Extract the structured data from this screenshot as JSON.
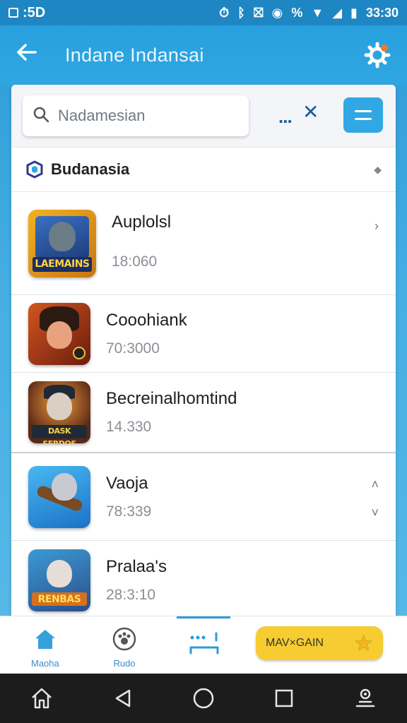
{
  "status_bar": {
    "left_text": ":5D",
    "time": "33:30",
    "percent_symbol": "%"
  },
  "app_bar": {
    "title": "Indane Indansai"
  },
  "search": {
    "placeholder": "Nadamesian",
    "more_label": "...",
    "close_label": "✕"
  },
  "section": {
    "title": "Budanasia"
  },
  "apps": [
    {
      "title": "Auplolsl",
      "subtitle": "18:060",
      "banner": "LAEMAINS",
      "bg": "#e9a01b",
      "face": "#6a7d87"
    },
    {
      "title": "Cooohiank",
      "subtitle": "70:3000",
      "banner": "",
      "bg": "#b5441c",
      "face": "#e8a27e"
    },
    {
      "title": "Becreinalhomtind",
      "subtitle": "14.330",
      "banner": "DASK SERDOS",
      "bg": "#2a2f3a",
      "face": "#d9cfc2"
    },
    {
      "title": "Vaoja",
      "subtitle": "78:339",
      "banner": "",
      "bg": "#2796e0",
      "face": "#c9c9d2"
    },
    {
      "title": "Pralaa's",
      "subtitle": "28:3:10",
      "banner": "RENBAS",
      "bg": "#3b6fa8",
      "face": "#e6ded6"
    }
  ],
  "bottom_nav": {
    "home_label": "Maoha",
    "second_label": "Rudo",
    "cta_label": "MAV×GAIN"
  },
  "colors": {
    "accent": "#2fa7e2",
    "cta": "#f6cc30"
  }
}
